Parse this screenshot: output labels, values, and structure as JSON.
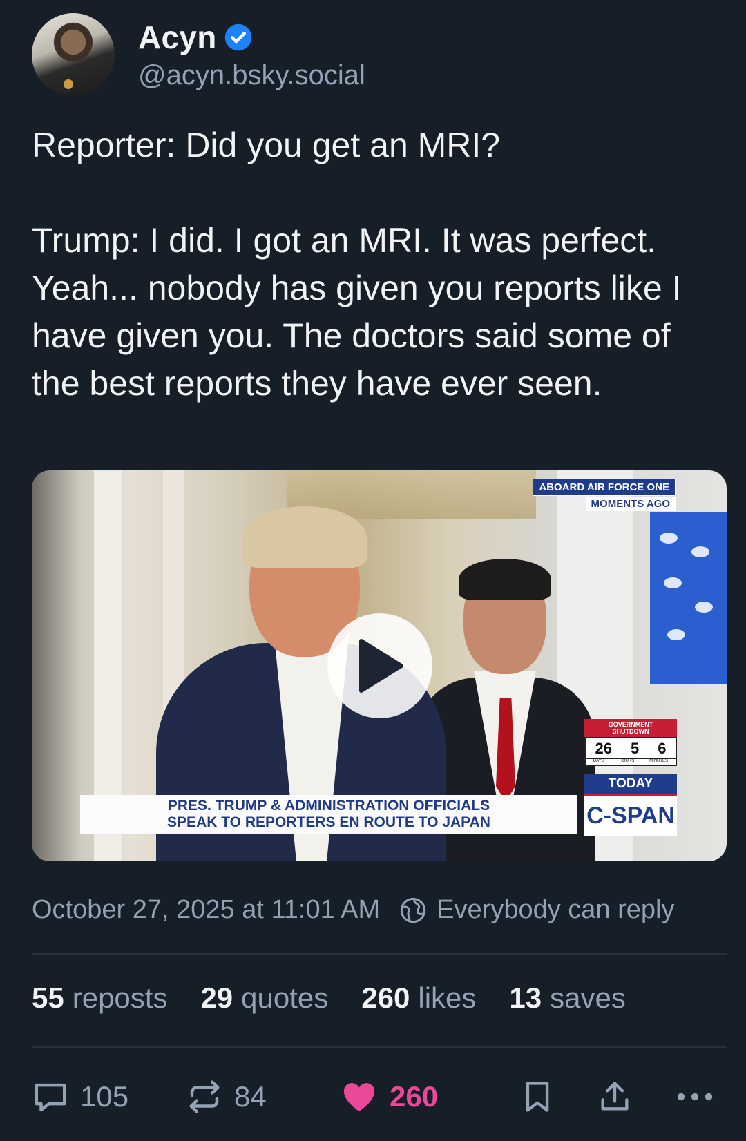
{
  "author": {
    "display_name": "Acyn",
    "handle": "@acyn.bsky.social",
    "verified": true,
    "verified_color": "#1d82f5"
  },
  "post": {
    "text": "Reporter: Did you get an MRI?\n\nTrump: I did. I got an MRI. It was perfect. Yeah...  nobody has given you reports like I have given you. The doctors said some of the best reports they have ever seen.",
    "timestamp": "October 27, 2025 at 11:01 AM",
    "reply_setting": "Everybody can reply"
  },
  "video": {
    "tag_aboard": "ABOARD AIR FORCE ONE",
    "tag_moments": "MOMENTS AGO",
    "chyron": "PRES. TRUMP & ADMINISTRATION OFFICIALS\nSPEAK TO REPORTERS EN ROUTE TO JAPAN",
    "shutdown_label": "GOVERNMENT\nSHUTDOWN",
    "countdown": {
      "days": "26",
      "hours": "5",
      "minutes": "6"
    },
    "countdown_units": {
      "days": "DAYS",
      "hours": "HOURS",
      "minutes": "MINUTES"
    },
    "today": "TODAY",
    "network": "C-SPAN",
    "play_icon": "play-icon"
  },
  "stats": {
    "reposts": {
      "count": "55",
      "label": "reposts"
    },
    "quotes": {
      "count": "29",
      "label": "quotes"
    },
    "likes": {
      "count": "260",
      "label": "likes"
    },
    "saves": {
      "count": "13",
      "label": "saves"
    }
  },
  "actions": {
    "reply": {
      "icon": "reply-icon",
      "count": "105"
    },
    "repost": {
      "icon": "repost-icon",
      "count": "84"
    },
    "like": {
      "icon": "heart-icon",
      "count": "260",
      "liked": true,
      "color": "#ec4899"
    },
    "bookmark": {
      "icon": "bookmark-icon"
    },
    "share": {
      "icon": "share-icon"
    },
    "more": {
      "icon": "more-icon"
    }
  },
  "colors": {
    "background": "#161e27",
    "muted_text": "#93a2b4",
    "primary_text": "#f1f3f5",
    "divider": "#262f3a"
  }
}
